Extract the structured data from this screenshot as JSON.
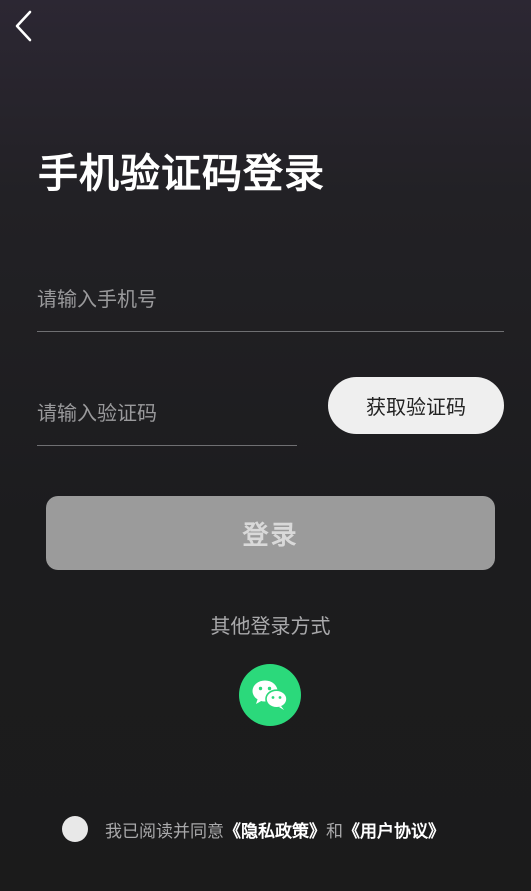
{
  "title": "手机验证码登录",
  "phone_input": {
    "placeholder": "请输入手机号",
    "value": ""
  },
  "code_input": {
    "placeholder": "请输入验证码",
    "value": ""
  },
  "get_code_label": "获取验证码",
  "login_label": "登录",
  "other_login_label": "其他登录方式",
  "other_login_icons": [
    "wechat-icon"
  ],
  "agreement": {
    "prefix": "我已阅读并同意",
    "privacy_link": "《隐私政策》",
    "conjunction": "和",
    "terms_link": "《用户协议》",
    "checked": false
  },
  "colors": {
    "background": "#1c1c1e",
    "login_button": "#9b9b9b",
    "wechat_green": "#2bd97b",
    "get_code_button": "#efefef"
  },
  "icons": {
    "back": "chevron-left-icon",
    "wechat": "wechat-icon"
  }
}
